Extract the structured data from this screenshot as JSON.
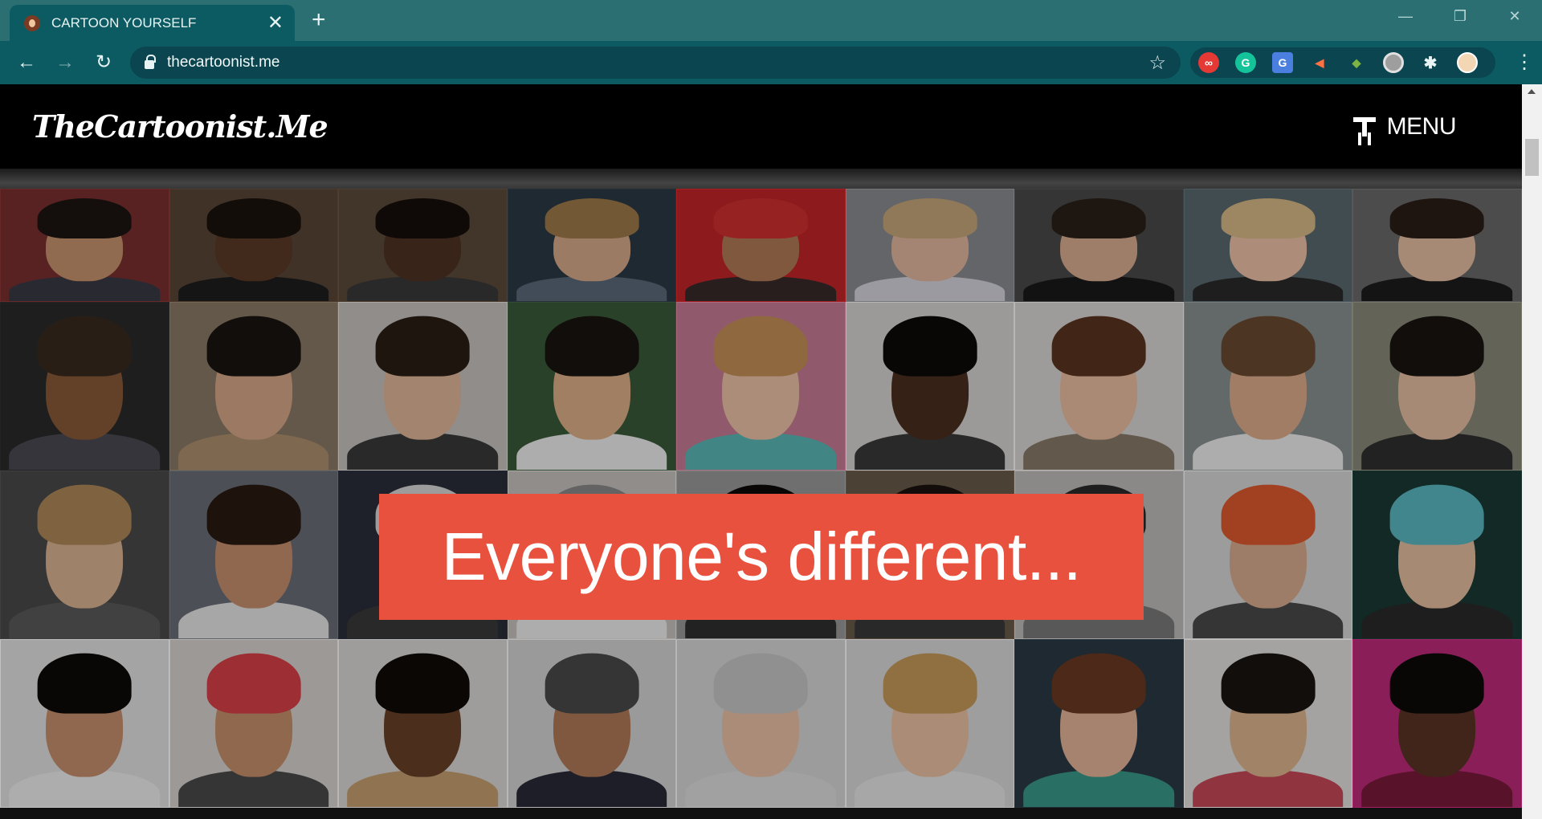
{
  "browser": {
    "tab_title": "CARTOON YOURSELF",
    "tab_close": "✕",
    "new_tab": "+",
    "url": "thecartoonist.me",
    "nav": {
      "back": "←",
      "forward": "→",
      "reload": "↻"
    },
    "bookmark_star": "☆",
    "window_controls": {
      "minimize": "—",
      "restore": "❐",
      "close": "✕"
    },
    "menu": "⋮",
    "extensions": [
      {
        "name": "infinity-extension-icon",
        "glyph": "∞"
      },
      {
        "name": "grammarly-icon",
        "glyph": "G"
      },
      {
        "name": "translate-icon",
        "glyph": "G"
      },
      {
        "name": "speaker-extension-icon",
        "glyph": "◀"
      },
      {
        "name": "globe-extension-icon",
        "glyph": "◆"
      },
      {
        "name": "circle-extension-icon",
        "glyph": ""
      },
      {
        "name": "puzzle-extensions-icon",
        "glyph": "✱"
      },
      {
        "name": "profile-avatar",
        "glyph": ""
      }
    ]
  },
  "site": {
    "logo": "TheCartoonist.Me",
    "menu_label": "MENU",
    "banner_text": "Everyone's different..."
  },
  "faces": [
    {
      "bg": "#7a3030",
      "skin": "#c9956e",
      "hair": "#1c1512",
      "body": "#3a3a44"
    },
    {
      "bg": "#5a4636",
      "skin": "#5a3a28",
      "hair": "#1a120d",
      "body": "#1e1e1e"
    },
    {
      "bg": "#5c4a3a",
      "skin": "#4e3222",
      "hair": "#160f0a",
      "body": "#3a3a3a"
    },
    {
      "bg": "#2c3a44",
      "skin": "#d9ab8c",
      "hair": "#a07a4a",
      "body": "#5a6a7a"
    },
    {
      "bg": "#c4262a",
      "skin": "#b07a56",
      "hair": "#d13030",
      "body": "#3a2a2a"
    },
    {
      "bg": "#8a8d90",
      "skin": "#e3b9a0",
      "hair": "#c8a87a",
      "body": "#d6d6de"
    },
    {
      "bg": "#4a4a4a",
      "skin": "#dcae92",
      "hair": "#2a2018",
      "body": "#1a1a1a"
    },
    {
      "bg": "#5a6a70",
      "skin": "#f0c4a8",
      "hair": "#d8bb88",
      "body": "#2a2a2a"
    },
    {
      "bg": "#6a6a6a",
      "skin": "#e8c0a4",
      "hair": "#2a1e18",
      "body": "#1c1c1c"
    },
    {
      "bg": "#2a2a2a",
      "skin": "#8a5a3a",
      "hair": "#3a2a1e",
      "body": "#4a4a52"
    },
    {
      "bg": "#8a7a66",
      "skin": "#d8a888",
      "hair": "#1a1410",
      "body": "#b09070"
    },
    {
      "bg": "#c8c4c0",
      "skin": "#e2b89a",
      "hair": "#2a1e16",
      "body": "#3a3a3a"
    },
    {
      "bg": "#3a5a3a",
      "skin": "#e0b08a",
      "hair": "#1a1410",
      "body": "#f0f0f0"
    },
    {
      "bg": "#c87c96",
      "skin": "#eec4a8",
      "hair": "#c89058",
      "body": "#5abab8"
    },
    {
      "bg": "#d8d6d4",
      "skin": "#4a2e1e",
      "hair": "#0c0a08",
      "body": "#3a3a3a"
    },
    {
      "bg": "#dad8d6",
      "skin": "#ecc0a2",
      "hair": "#5a3420",
      "body": "#8a7a6a"
    },
    {
      "bg": "#8a9090",
      "skin": "#e0ae8c",
      "hair": "#6a4a30",
      "body": "#f0f0f0"
    },
    {
      "bg": "#8a8a7a",
      "skin": "#e8c0a4",
      "hair": "#1a1410",
      "body": "#303030"
    },
    {
      "bg": "#4a4a4a",
      "skin": "#dcb494",
      "hair": "#b08a5a",
      "body": "#5a5a5a"
    },
    {
      "bg": "#6a7078",
      "skin": "#c89070",
      "hair": "#2a1a12",
      "body": "#e8e8e8"
    },
    {
      "bg": "#2a2e3a",
      "skin": "#e2c0a8",
      "hair": "#d8d8d8",
      "body": "#3a3a3a"
    },
    {
      "bg": "#c8c4c0",
      "skin": "#dcb090",
      "hair": "#8a8a8a",
      "body": "#f0f0f0"
    },
    {
      "bg": "#9a9a9a",
      "skin": "#4a3020",
      "hair": "#0c0a08",
      "body": "#303030"
    },
    {
      "bg": "#6a5a4a",
      "skin": "#6a4430",
      "hair": "#1a1210",
      "body": "#3a3a3a"
    },
    {
      "bg": "#c0bebc",
      "skin": "#6a4a36",
      "hair": "#2a2a2a",
      "body": "#7a7a7a"
    },
    {
      "bg": "#d8d8d8",
      "skin": "#dcae90",
      "hair": "#e05a30",
      "body": "#4a4a4a"
    },
    {
      "bg": "#1a3a34",
      "skin": "#e8c0a0",
      "hair": "#5abac4",
      "body": "#2a2a2a"
    },
    {
      "bg": "#e4e4e4",
      "skin": "#c89070",
      "hair": "#0c0a08",
      "body": "#f0f0f0"
    },
    {
      "bg": "#d8d4d0",
      "skin": "#c8906c",
      "hair": "#d84048",
      "body": "#4a4a4a"
    },
    {
      "bg": "#dcdad8",
      "skin": "#6a4028",
      "hair": "#0e0a08",
      "body": "#c8a070"
    },
    {
      "bg": "#d6d6d6",
      "skin": "#b07a58",
      "hair": "#4a4a4a",
      "body": "#2a2a3a"
    },
    {
      "bg": "#d8d8d8",
      "skin": "#ecc2a8",
      "hair": "#c8c8c8",
      "body": "#e0e0e0"
    },
    {
      "bg": "#dcdcdc",
      "skin": "#eec4a6",
      "hair": "#c89a5a",
      "body": "#e8e8e8"
    },
    {
      "bg": "#2a3a44",
      "skin": "#e6b69a",
      "hair": "#6a3a22",
      "body": "#3a9a8a"
    },
    {
      "bg": "#e4e2e0",
      "skin": "#e0b890",
      "hair": "#1a1410",
      "body": "#c84858"
    },
    {
      "bg": "#c02a7a",
      "skin": "#5a3424",
      "hair": "#0c0a08",
      "body": "#7a1a3a"
    }
  ]
}
